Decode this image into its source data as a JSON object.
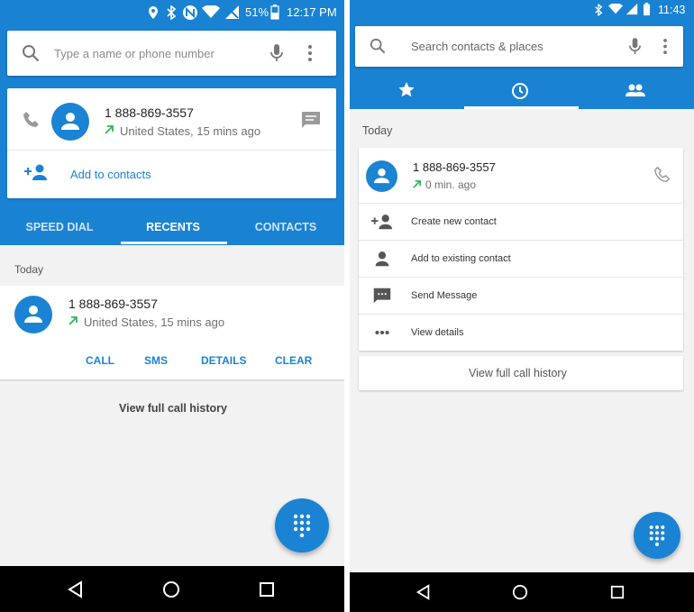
{
  "left": {
    "status": {
      "battery": "51%",
      "time": "12:17 PM"
    },
    "search": {
      "placeholder": "Type a name or phone number"
    },
    "top_card": {
      "number": "1 888-869-3557",
      "detail": "United States, 15 mins ago",
      "add_label": "Add to contacts"
    },
    "tabs": [
      "SPEED DIAL",
      "RECENTS",
      "CONTACTS"
    ],
    "section": "Today",
    "entry": {
      "number": "1 888-869-3557",
      "detail": "United States, 15 mins ago",
      "actions": [
        "CALL",
        "SMS",
        "DETAILS",
        "CLEAR"
      ]
    },
    "history_label": "View full call history"
  },
  "right": {
    "status": {
      "time": "11:43"
    },
    "search": {
      "placeholder": "Search contacts & places"
    },
    "section": "Today",
    "entry": {
      "number": "1 888-869-3557",
      "detail": "0 min. ago",
      "menu": [
        "Create new contact",
        "Add to existing contact",
        "Send Message",
        "View details"
      ]
    },
    "history_label": "View full call history"
  },
  "colors": {
    "accent": "#1a82d2",
    "green_arrow": "#2fb45a"
  }
}
